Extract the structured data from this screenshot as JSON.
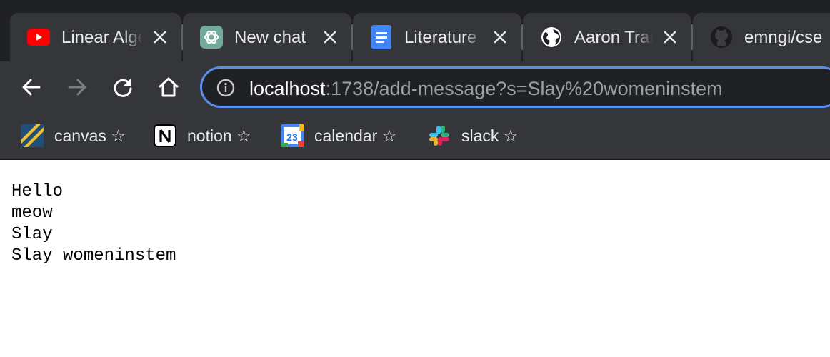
{
  "tabs": [
    {
      "title": "Linear Algebra",
      "icon": "youtube-icon"
    },
    {
      "title": "New chat",
      "icon": "chatgpt-icon"
    },
    {
      "title": "Literature",
      "icon": "google-docs-icon"
    },
    {
      "title": "Aaron Tran",
      "icon": "globe-icon"
    },
    {
      "title": "emngi/cse",
      "icon": "github-icon"
    }
  ],
  "toolbar": {
    "url_host": "localhost",
    "url_rest": ":1738/add-message?s=Slay%20womeninstem"
  },
  "bookmarks": [
    {
      "label": "canvas ☆",
      "icon": "canvas-icon"
    },
    {
      "label": "notion ☆",
      "icon": "notion-icon"
    },
    {
      "label": "calendar ☆",
      "icon": "calendar-icon",
      "day": "23"
    },
    {
      "label": "slack ☆",
      "icon": "slack-icon"
    }
  ],
  "page": {
    "lines": [
      "Hello",
      "meow",
      "Slay",
      "Slay womeninstem"
    ]
  },
  "colors": {
    "chrome_dark": "#202124",
    "chrome_mid": "#35363a",
    "omnibox_focus": "#5b8def",
    "youtube_red": "#ff0000"
  }
}
